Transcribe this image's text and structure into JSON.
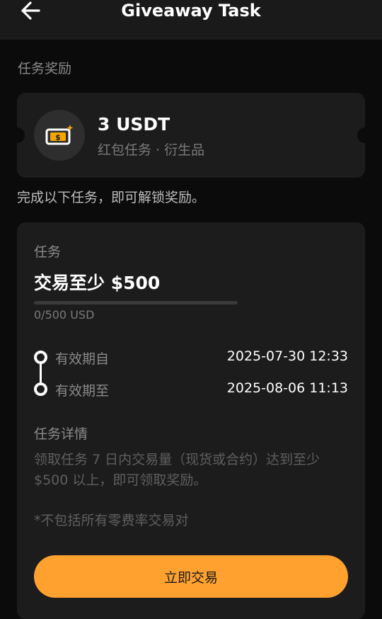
{
  "header": {
    "title": "Giveaway Task",
    "back_icon": "arrow-left-icon"
  },
  "reward_section": {
    "label": "任务奖励",
    "amount": "3 USDT",
    "subtitle": "红包任务 · 衍生品",
    "icon": "money-ticket-icon",
    "accent_color": "#f7a600"
  },
  "instruction": "完成以下任务，即可解锁奖励。",
  "task": {
    "label": "任务",
    "title": "交易至少 $500",
    "progress_fraction": 0.0,
    "progress_text": "0/500 USD",
    "valid_from_label": "有效期自",
    "valid_from": "2025-07-30 12:33",
    "valid_to_label": "有效期至",
    "valid_to": "2025-08-06 11:13",
    "details_label": "任务详情",
    "details_text": "领取任务 7 日内交易量（现货或合约）达到至少 $500 以上，即可领取奖励。",
    "note": "*不包括所有零费率交易对",
    "button_label": "立即交易",
    "button_color": "#ffa12e"
  }
}
